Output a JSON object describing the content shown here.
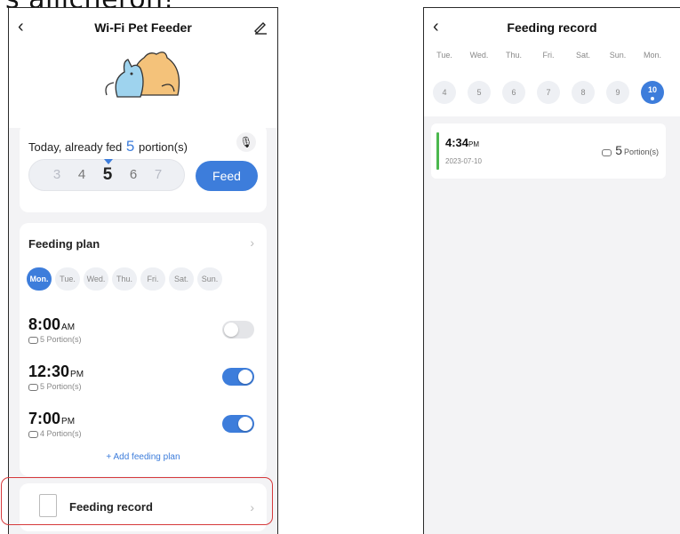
{
  "caption_fragment": "s allicheron!",
  "colors": {
    "accent": "#3d7ddb",
    "record_bar": "#4bb84e",
    "highlight": "#d6393b"
  },
  "left": {
    "nav": {
      "back_icon": "chevron-left-icon",
      "title": "Wi-Fi Pet Feeder",
      "edit_icon": "pencil-icon"
    },
    "today": {
      "prefix": "Today, already fed",
      "count": "5",
      "suffix": "portion(s)",
      "mic_icon": "microphone-icon",
      "picker": [
        "3",
        "4",
        "5",
        "6",
        "7"
      ],
      "selected": "5",
      "feed_label": "Feed"
    },
    "plan": {
      "title": "Feeding plan",
      "days": [
        "Mon.",
        "Tue.",
        "Wed.",
        "Thu.",
        "Fri.",
        "Sat.",
        "Sun."
      ],
      "active_day": "Mon.",
      "items": [
        {
          "time": "8:00",
          "ampm": "AM",
          "portion": "5 Portion(s)",
          "enabled": false
        },
        {
          "time": "12:30",
          "ampm": "PM",
          "portion": "5 Portion(s)",
          "enabled": true
        },
        {
          "time": "7:00",
          "ampm": "PM",
          "portion": "4 Portion(s)",
          "enabled": true
        }
      ],
      "add_label": "+ Add feeding plan"
    },
    "record": {
      "label": "Feeding record"
    }
  },
  "right": {
    "nav": {
      "back_icon": "chevron-left-icon",
      "title": "Feeding record"
    },
    "week_days": [
      "Tue.",
      "Wed.",
      "Thu.",
      "Fri.",
      "Sat.",
      "Sun.",
      "Mon."
    ],
    "week_dates": [
      "4",
      "5",
      "6",
      "7",
      "8",
      "9",
      "10"
    ],
    "active_date": "10",
    "entries": [
      {
        "time": "4:34",
        "ampm": "PM",
        "date": "2023-07-10",
        "amount": "5",
        "unit": "Portion(s)"
      }
    ]
  }
}
